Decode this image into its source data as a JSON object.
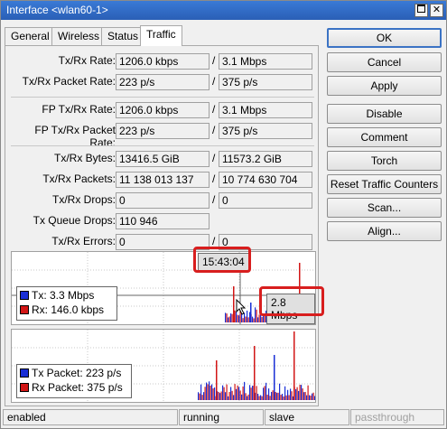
{
  "window": {
    "title": "Interface <wlan60-1>"
  },
  "tabs": [
    {
      "label": "General"
    },
    {
      "label": "Wireless"
    },
    {
      "label": "Status"
    },
    {
      "label": "Traffic"
    }
  ],
  "fields": {
    "txrx_rate": {
      "label": "Tx/Rx Rate:",
      "tx": "1206.0 kbps",
      "rx": "3.1 Mbps"
    },
    "txrx_packet_rate": {
      "label": "Tx/Rx Packet Rate:",
      "tx": "223 p/s",
      "rx": "375 p/s"
    },
    "fp_txrx_rate": {
      "label": "FP Tx/Rx Rate:",
      "tx": "1206.0 kbps",
      "rx": "3.1 Mbps"
    },
    "fp_txrx_packet_rate": {
      "label": "FP Tx/Rx Packet Rate:",
      "tx": "223 p/s",
      "rx": "375 p/s"
    },
    "txrx_bytes": {
      "label": "Tx/Rx Bytes:",
      "tx": "13416.5 GiB",
      "rx": "11573.2 GiB"
    },
    "txrx_packets": {
      "label": "Tx/Rx Packets:",
      "tx": "11 138 013 137",
      "rx": "10 774 630 704"
    },
    "txrx_drops": {
      "label": "Tx/Rx Drops:",
      "tx": "0",
      "rx": "0"
    },
    "tx_queue_drops": {
      "label": "Tx Queue Drops:",
      "value": "110 946"
    },
    "txrx_errors": {
      "label": "Tx/Rx Errors:",
      "tx": "0",
      "rx": "0"
    }
  },
  "traffic_graph": {
    "legend_tx": "Tx:  3.3 Mbps",
    "legend_rx": "Rx:  146.0 kbps",
    "tooltip_time": "15:43:04",
    "tooltip_value": "2.8 Mbps",
    "tx_color": "#1a2fd6",
    "rx_color": "#d21616"
  },
  "packet_graph": {
    "legend_tx": "Tx Packet:  223 p/s",
    "legend_rx": "Rx Packet:  375 p/s"
  },
  "buttons": [
    {
      "label": "OK"
    },
    {
      "label": "Cancel"
    },
    {
      "label": "Apply"
    },
    {
      "label": "Disable"
    },
    {
      "label": "Comment"
    },
    {
      "label": "Torch"
    },
    {
      "label": "Reset Traffic Counters"
    },
    {
      "label": "Scan..."
    },
    {
      "label": "Align..."
    }
  ],
  "status_bar": {
    "state": "enabled",
    "run": "running",
    "mode": "slave",
    "passthrough": "passthrough"
  }
}
